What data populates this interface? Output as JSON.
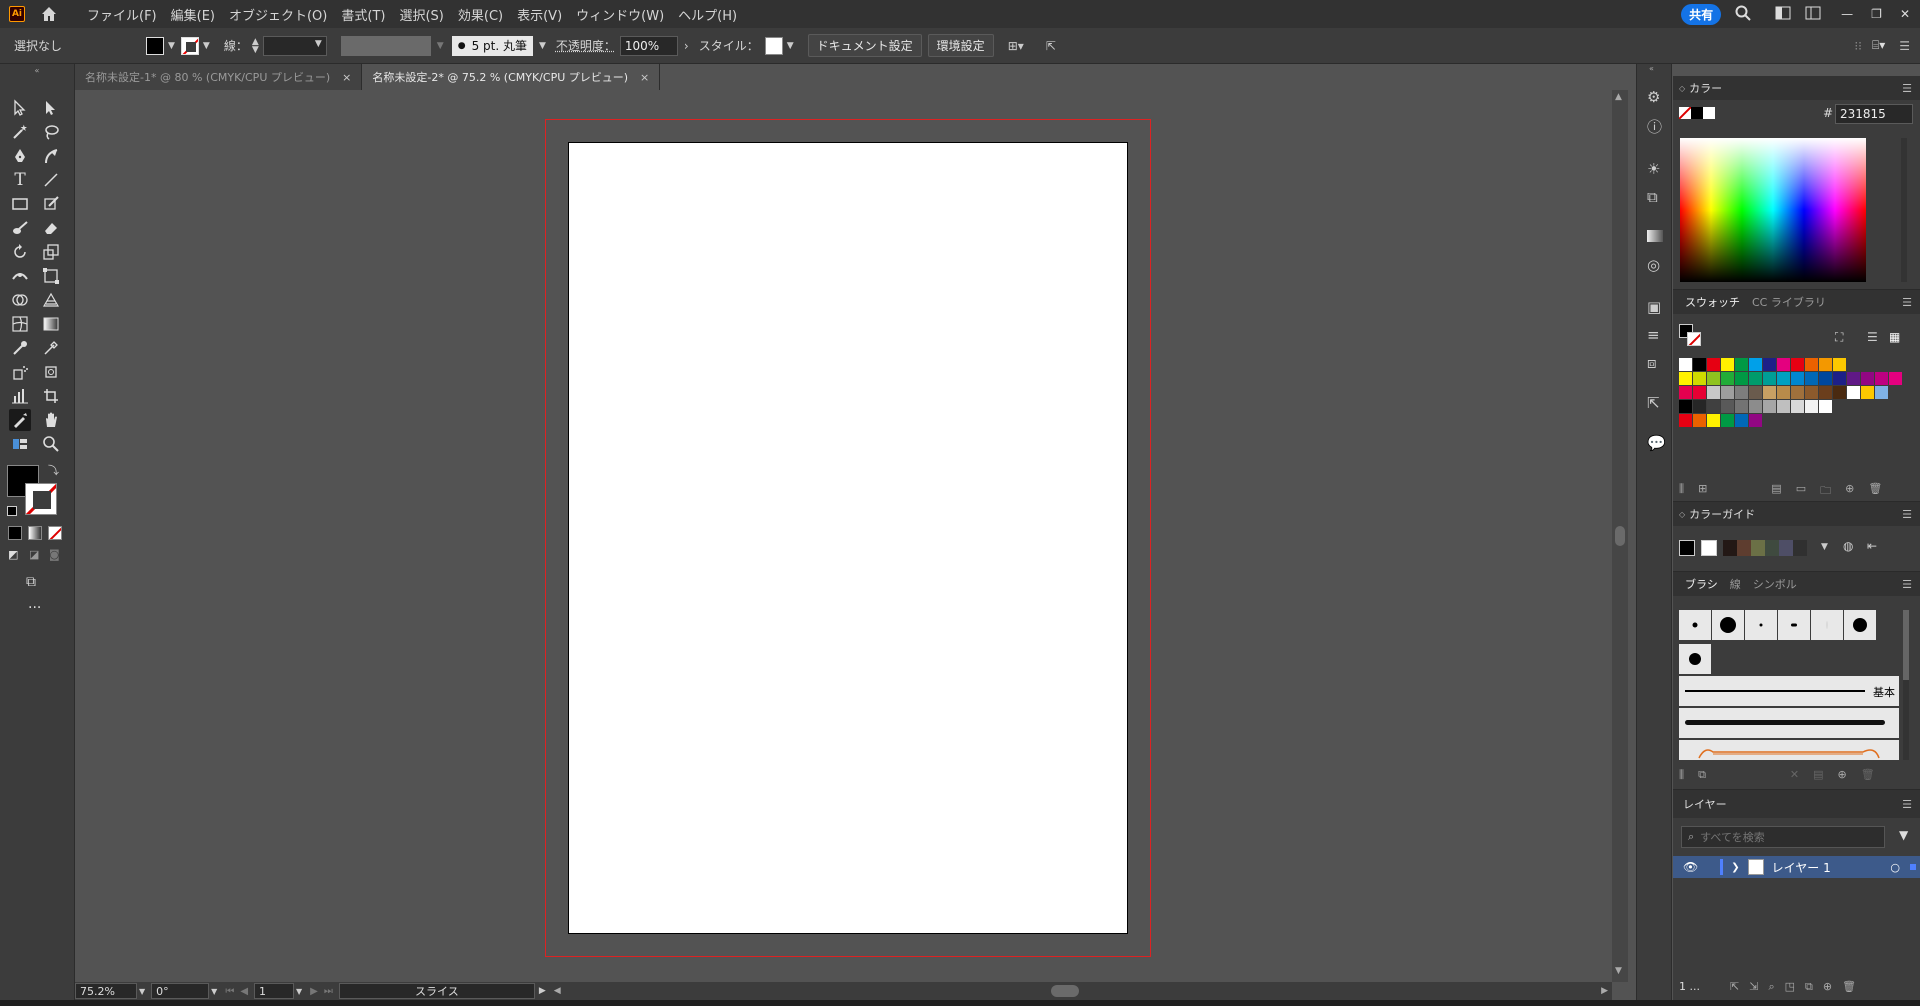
{
  "app": {
    "logo_text": "Ai",
    "share_label": "共有"
  },
  "menu": [
    "ファイル(F)",
    "編集(E)",
    "オブジェクト(O)",
    "書式(T)",
    "選択(S)",
    "効果(C)",
    "表示(V)",
    "ウィンドウ(W)",
    "ヘルプ(H)"
  ],
  "control_bar": {
    "selection": "選択なし",
    "stroke_label": "線：",
    "brush_label": "5 pt. 丸筆",
    "opacity_label": "不透明度：",
    "opacity_value": "100%",
    "style_label": "スタイル：",
    "doc_setup": "ドキュメント設定",
    "prefs": "環境設定"
  },
  "tabs": [
    {
      "label": "名称未設定-1* @ 80 % (CMYK/CPU プレビュー)",
      "close": "×"
    },
    {
      "label": "名称未設定-2* @ 75.2 % (CMYK/CPU プレビュー)",
      "close": "×"
    }
  ],
  "status": {
    "zoom": "75.2%",
    "rotate": "0°",
    "page": "1",
    "tool": "スライス"
  },
  "color_panel": {
    "title": "カラー",
    "hash": "#",
    "hex": "231815"
  },
  "swatches_panel": {
    "tab1": "スウォッチ",
    "tab2": "CC ライブラリ"
  },
  "color_guide": {
    "title": "カラーガイド"
  },
  "brush_panel": {
    "tab1": "ブラシ",
    "tab2": "線",
    "tab3": "シンボル",
    "basic": "基本"
  },
  "layers_panel": {
    "title": "レイヤー",
    "search_placeholder": "すべてを検索",
    "layer_name": "レイヤー 1",
    "count": "1 ..."
  },
  "colors": {
    "swatch_row1": [
      "#ffffff",
      "#000000",
      "#e60012",
      "#fff100",
      "#009944",
      "#00a0e9",
      "#1d2088",
      "#e4007f",
      "#e60012",
      "#eb6100",
      "#f39800",
      "#fcc800"
    ],
    "swatch_row2": [
      "#fff100",
      "#cfdb00",
      "#8fc31f",
      "#22ac38",
      "#009944",
      "#009b6b",
      "#009e96",
      "#00a0c1",
      "#0086d1",
      "#0068b7",
      "#00479d",
      "#1d2088",
      "#601986",
      "#920783",
      "#be0081",
      "#e4007f"
    ],
    "swatch_row3": [
      "#e5004f",
      "#e60033",
      "#c8c8c8",
      "#9e9e9e",
      "#7d7d7d",
      "#6a5b4d",
      "#c8a063",
      "#b88b4a",
      "#a0703c",
      "#8c5a2c",
      "#6b3e1c",
      "#4a2a10",
      "#ffffff",
      "#fcc800",
      "#7fb2e5"
    ],
    "swatch_row4": [
      "#000000",
      "#262626",
      "#404040",
      "#595959",
      "#737373",
      "#8c8c8c",
      "#a6a6a6",
      "#bfbfbf",
      "#d9d9d9",
      "#f2f2f2",
      "#ffffff"
    ],
    "swatch_row5": [
      "#e60012",
      "#eb6100",
      "#fff100",
      "#009944",
      "#0068b7",
      "#920783"
    ],
    "guide": [
      "#000000",
      "#ffffff",
      "#231815",
      "#5e3d2f",
      "#6b7046",
      "#3f4a3f",
      "#4e4e66",
      "#303030"
    ]
  }
}
